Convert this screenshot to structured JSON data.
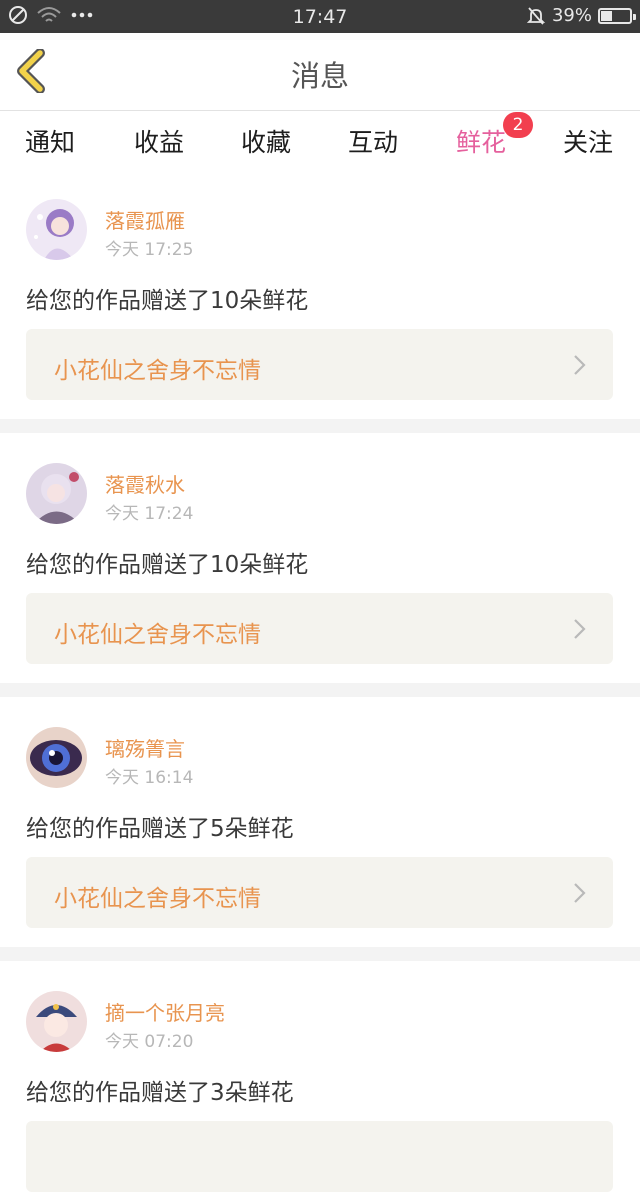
{
  "status_bar": {
    "time": "17:47",
    "battery": "39%",
    "battery_level": 0.39
  },
  "header": {
    "title": "消息"
  },
  "tabs": [
    {
      "label": "通知"
    },
    {
      "label": "收益"
    },
    {
      "label": "收藏"
    },
    {
      "label": "互动"
    },
    {
      "label": "鲜花",
      "badge": "2",
      "active": true
    },
    {
      "label": "关注"
    }
  ],
  "messages": [
    {
      "user": "落霞孤雁",
      "time": "今天 17:25",
      "text": "给您的作品赠送了10朵鲜花",
      "work": "小花仙之舍身不忘情"
    },
    {
      "user": "落霞秋水",
      "time": "今天 17:24",
      "text": "给您的作品赠送了10朵鲜花",
      "work": "小花仙之舍身不忘情"
    },
    {
      "user": "璃殇箐言",
      "time": "今天 16:14",
      "text": "给您的作品赠送了5朵鲜花",
      "work": "小花仙之舍身不忘情"
    },
    {
      "user": "摘一个张月亮",
      "time": "今天 07:20",
      "text": "给您的作品赠送了3朵鲜花",
      "work": ""
    }
  ],
  "colors": {
    "accent_pink": "#e5609d",
    "name_orange": "#e8944f",
    "back_arrow": "#f2d24a",
    "badge_red": "#f23f4f"
  },
  "icons": {
    "back": "chevron-left-icon",
    "arrow": "chevron-right-icon",
    "battery": "battery-icon",
    "wifi": "wifi-icon",
    "mute": "bell-off-icon",
    "dnd": "do-not-disturb-icon"
  }
}
